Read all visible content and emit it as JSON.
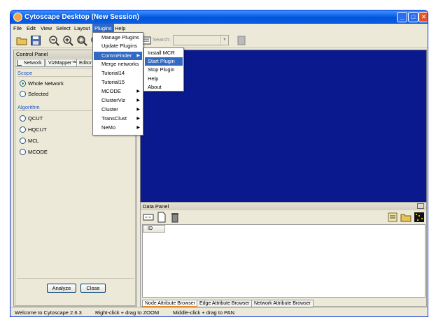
{
  "window": {
    "title": "Cytoscape Desktop (New Session)"
  },
  "menubar": {
    "items": [
      "File",
      "Edit",
      "View",
      "Select",
      "Layout",
      "Plugins",
      "Help"
    ],
    "active": "Plugins"
  },
  "toolbar": {
    "icons": [
      "open-folder-icon",
      "save-icon",
      "zoom-out-icon",
      "zoom-in-icon",
      "zoom-fit-icon",
      "zoom-selected-icon",
      "vizmapper-icon",
      "details-icon"
    ],
    "search_label": "Search:",
    "search_value": ""
  },
  "plugins_menu": {
    "items": [
      {
        "label": "Manage Plugins",
        "submenu": false
      },
      {
        "label": "Update Plugins",
        "submenu": false
      },
      {
        "label": "CommFinder",
        "submenu": true
      },
      {
        "label": "Merge networks",
        "submenu": false
      },
      {
        "label": "Tutorial14",
        "submenu": false
      },
      {
        "label": "Tutorial15",
        "submenu": false
      },
      {
        "label": "MCODE",
        "submenu": true
      },
      {
        "label": "ClusterViz",
        "submenu": true
      },
      {
        "label": "Cluster",
        "submenu": true
      },
      {
        "label": "TransClust",
        "submenu": true
      },
      {
        "label": "NeMo",
        "submenu": true
      }
    ],
    "highlighted": "CommFinder"
  },
  "commfinder_menu": {
    "items": [
      "Install MCR",
      "Start Plugin",
      "Stop Plugin",
      "Help",
      "About"
    ],
    "highlighted": "Start Plugin"
  },
  "control_panel": {
    "title": "Control Panel",
    "tabs": [
      "Network",
      "VizMapper™",
      "Editor"
    ],
    "scope": {
      "title": "Scope",
      "options": [
        "Whole Network",
        "Selected"
      ],
      "selected": "Whole Network"
    },
    "algorithm": {
      "title": "Algorithm",
      "options": [
        "QCUT",
        "HQCUT",
        "MCL",
        "MCODE"
      ]
    },
    "analyze_label": "Analyze",
    "close_label": "Close"
  },
  "data_panel": {
    "title": "Data Panel",
    "columns": [
      "ID"
    ],
    "tabs": [
      "Node Attribute Browser",
      "Edge Attribute Browser",
      "Network Attribute Browser"
    ],
    "active_tab": "Node Attribute Browser"
  },
  "status_bar": {
    "welcome": "Welcome to Cytoscape 2.6.3",
    "hint_zoom": "Right-click + drag  to  ZOOM",
    "hint_pan": "Middle-click + drag  to  PAN"
  },
  "colors": {
    "network_background": "#0a1a8e",
    "menu_highlight": "#316ac5",
    "titlebar": "#0a5fe4"
  }
}
